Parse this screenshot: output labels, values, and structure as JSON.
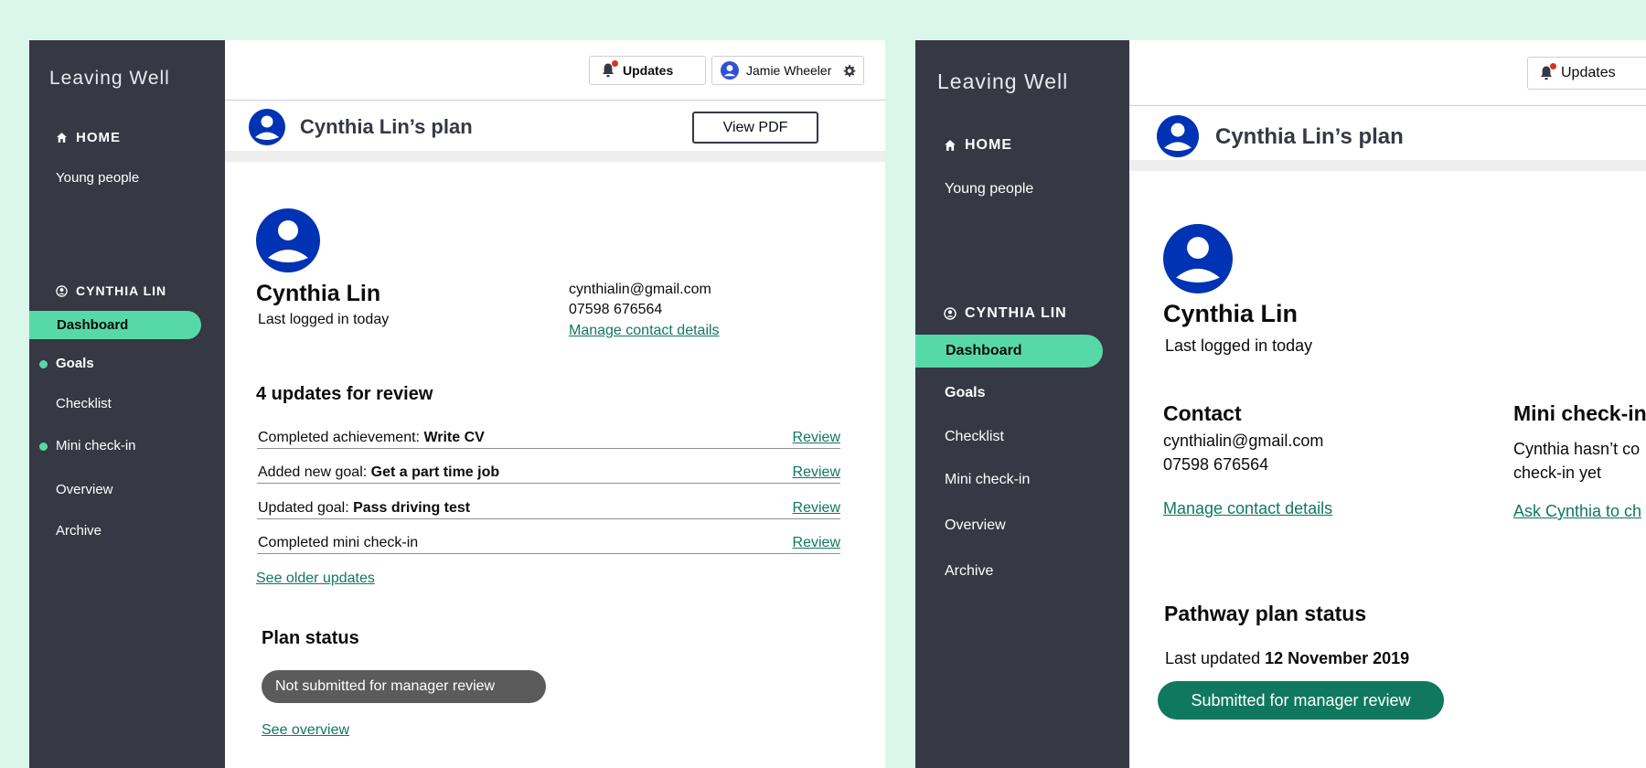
{
  "brand": "Leaving Well",
  "nav": {
    "home": "HOME",
    "young_people": "Young people",
    "person_section": "CYNTHIA LIN",
    "dashboard": "Dashboard",
    "goals": "Goals",
    "checklist": "Checklist",
    "mini_checkin": "Mini check-in",
    "overview": "Overview",
    "archive": "Archive"
  },
  "topbar": {
    "updates_label": "Updates",
    "user_name": "Jamie Wheeler"
  },
  "plan": {
    "title": "Cynthia Lin’s plan",
    "view_pdf": "View PDF"
  },
  "profile": {
    "name": "Cynthia Lin",
    "last_logged": "Last logged in today",
    "email": "cynthialin@gmail.com",
    "phone": "07598 676564",
    "manage_link": "Manage contact details"
  },
  "updates": {
    "heading": "4 updates for review",
    "items": [
      {
        "prefix": "Completed achievement: ",
        "bold": "Write CV",
        "action": "Review"
      },
      {
        "prefix": "Added new goal: ",
        "bold": "Get a part time job",
        "action": "Review"
      },
      {
        "prefix": "Updated goal: ",
        "bold": "Pass driving test",
        "action": "Review"
      },
      {
        "prefix": "Completed mini check-in",
        "bold": "",
        "action": "Review"
      }
    ],
    "older_link": "See older updates"
  },
  "plan_status": {
    "heading": "Plan status",
    "badge": "Not submitted for manager review",
    "overview_link": "See overview"
  },
  "right": {
    "contact_heading": "Contact",
    "mini_heading": "Mini check-in",
    "mini_text_line1": "Cynthia hasn’t co",
    "mini_text_line2": "check-in yet",
    "ask_link": "Ask Cynthia to ch",
    "pathway_heading": "Pathway plan status",
    "last_updated_prefix": "Last updated ",
    "last_updated_date": "12 November 2019",
    "submitted_badge": "Submitted for manager review"
  },
  "colors": {
    "background": "#dbf7ec",
    "sidebar": "#363844",
    "active_nav": "#57d9a7",
    "link": "#10785e",
    "avatar": "#0032b4",
    "badge_grey": "#5b5b5b",
    "badge_green": "#10785e"
  }
}
